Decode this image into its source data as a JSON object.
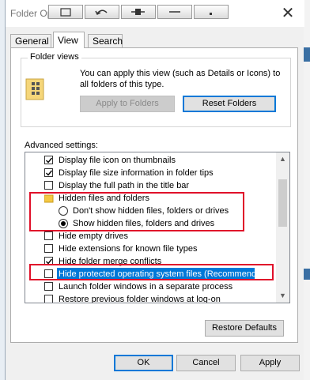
{
  "window": {
    "title": "Folder Options",
    "close_glyph": "✕"
  },
  "tabs": [
    {
      "label": "General",
      "active": false
    },
    {
      "label": "View",
      "active": true
    },
    {
      "label": "Search",
      "active": false
    }
  ],
  "folder_views": {
    "legend": "Folder views",
    "description": "You can apply this view (such as Details or Icons) to all folders of this type.",
    "apply_button": "Apply to Folders",
    "reset_button": "Reset Folders"
  },
  "advanced": {
    "label": "Advanced settings:",
    "items": [
      {
        "type": "checkbox",
        "checked": true,
        "label": "Display file icon on thumbnails"
      },
      {
        "type": "checkbox",
        "checked": true,
        "label": "Display file size information in folder tips"
      },
      {
        "type": "checkbox",
        "checked": false,
        "label": "Display the full path in the title bar"
      },
      {
        "type": "folder",
        "label": "Hidden files and folders"
      },
      {
        "type": "radio",
        "checked": false,
        "label": "Don't show hidden files, folders or drives"
      },
      {
        "type": "radio",
        "checked": true,
        "label": "Show hidden files, folders and drives"
      },
      {
        "type": "checkbox",
        "checked": false,
        "label": "Hide empty drives"
      },
      {
        "type": "checkbox",
        "checked": false,
        "label": "Hide extensions for known file types"
      },
      {
        "type": "checkbox",
        "checked": true,
        "label": "Hide folder merge conflicts"
      },
      {
        "type": "checkbox",
        "checked": false,
        "label": "Hide protected operating system files (Recommended)",
        "highlighted": true
      },
      {
        "type": "checkbox",
        "checked": false,
        "label": "Launch folder windows in a separate process"
      },
      {
        "type": "checkbox",
        "checked": false,
        "label": "Restore previous folder windows at log-on"
      }
    ]
  },
  "restore_defaults_button": "Restore Defaults",
  "footer": {
    "ok": "OK",
    "cancel": "Cancel",
    "apply": "Apply"
  },
  "colors": {
    "highlight": "#0078d7",
    "annotation_red": "#e0102a",
    "focus_border": "#0078d7"
  }
}
